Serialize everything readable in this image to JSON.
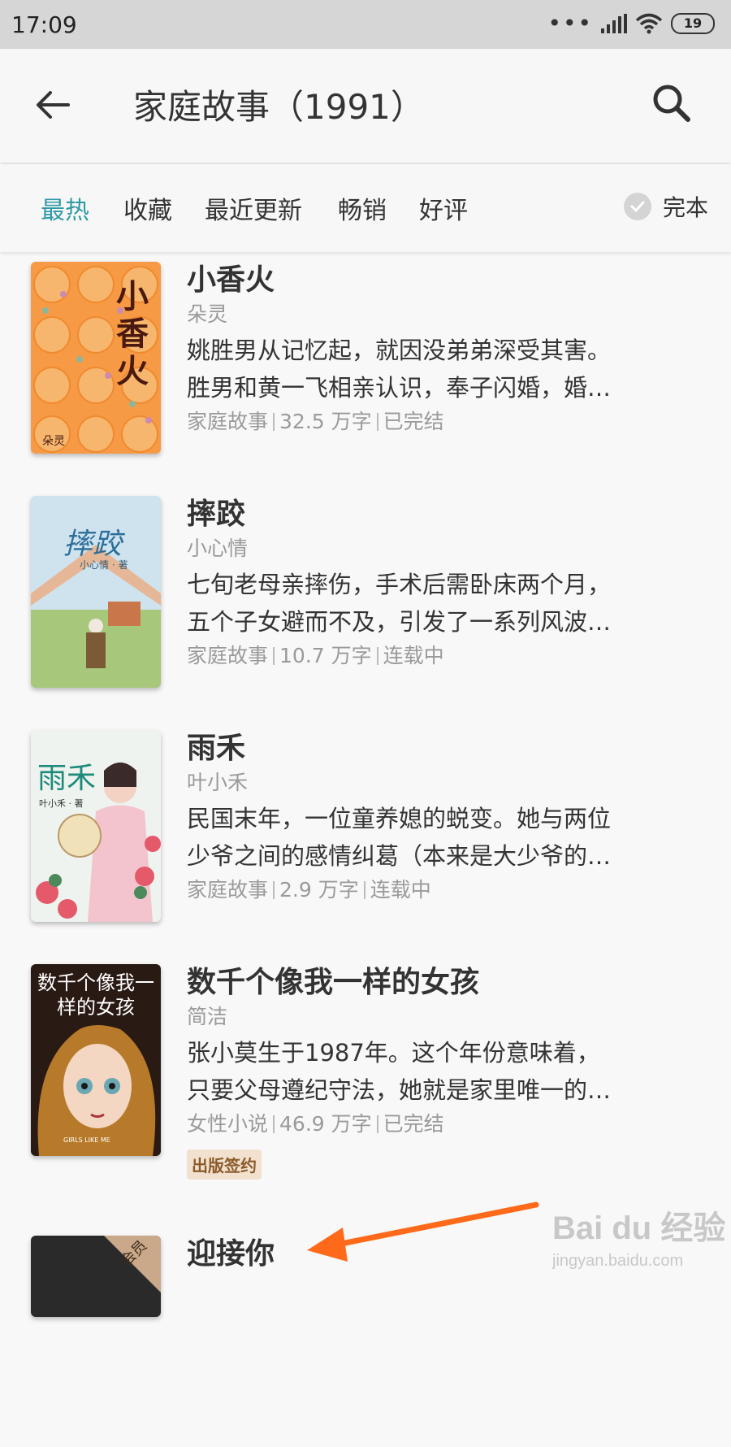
{
  "status_bar": {
    "time": "17:09",
    "battery": "19"
  },
  "app_bar": {
    "title": "家庭故事（1991）"
  },
  "filters": {
    "tabs": [
      {
        "label": "最热",
        "active": true
      },
      {
        "label": "收藏",
        "active": false
      },
      {
        "label": "最近更新",
        "active": false
      },
      {
        "label": "畅销",
        "active": false
      },
      {
        "label": "好评",
        "active": false
      }
    ],
    "complete_label": "完本"
  },
  "books": [
    {
      "title": "小香火",
      "author": "朵灵",
      "desc1": "姚胜男从记忆起，就因没弟弟深受其害。",
      "desc2": "胜男和黄一飞相亲认识，奉子闪婚，婚…",
      "category": "家庭故事",
      "words": "32.5 万字",
      "status": "已完结",
      "cover_text": "小香火",
      "cover_author": "朵灵"
    },
    {
      "title": "摔跤",
      "author": "小心情",
      "desc1": "七旬老母亲摔伤，手术后需卧床两个月，",
      "desc2": "五个子女避而不及，引发了一系列风波…",
      "category": "家庭故事",
      "words": "10.7 万字",
      "status": "连载中",
      "cover_text": "摔跤",
      "cover_author": "小心情 · 著"
    },
    {
      "title": "雨禾",
      "author": "叶小禾",
      "desc1": "民国末年，一位童养媳的蜕变。她与两位",
      "desc2": "少爷之间的感情纠葛（本来是大少爷的…",
      "category": "家庭故事",
      "words": "2.9 万字",
      "status": "连载中",
      "cover_text": "雨禾",
      "cover_author": "叶小禾 · 著"
    },
    {
      "title": "数千个像我一样的女孩",
      "author": "简洁",
      "desc1": "张小莫生于1987年。这个年份意味着，",
      "desc2": "只要父母遵纪守法，她就是家里唯一的…",
      "category": "女性小说",
      "words": "46.9 万字",
      "status": "已完结",
      "badge": "出版签约",
      "cover_text": "数千个像我一样的女孩",
      "cover_sub": "GIRLS LIKE ME"
    },
    {
      "title": "迎接你",
      "cover_tag": "会员"
    }
  ],
  "watermark": {
    "main": "Bai du 经验",
    "sub": "jingyan.baidu.com"
  }
}
